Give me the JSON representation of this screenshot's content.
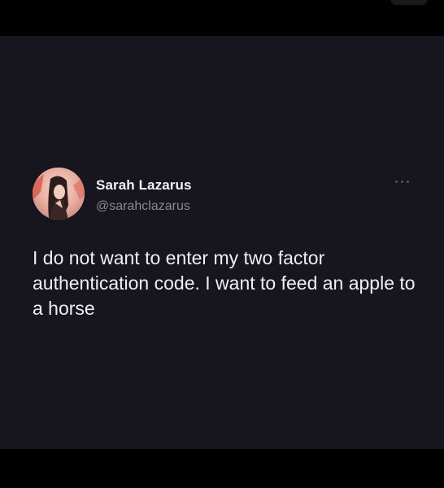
{
  "tweet": {
    "author_name": "Sarah Lazarus",
    "author_handle": "@sarahclazarus",
    "text": "I do not want to enter my two factor authentication code. I want to feed an apple to a horse",
    "more_icon": "more-horizontal-icon"
  },
  "colors": {
    "background": "#17151d",
    "frame": "#000000",
    "text_primary": "#efeff2",
    "text_secondary": "#8a8894"
  }
}
